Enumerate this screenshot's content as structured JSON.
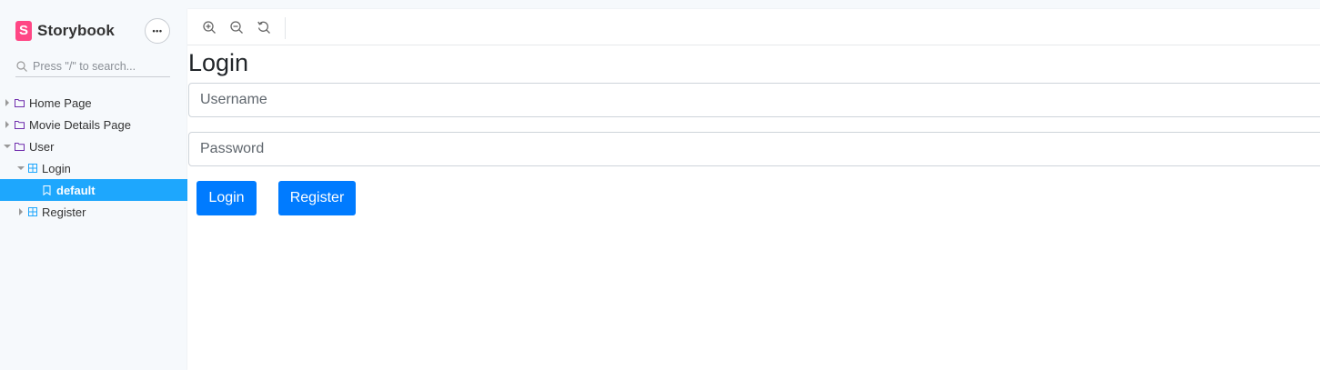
{
  "app": {
    "brand": "Storybook",
    "menu_glyph": "•••"
  },
  "search": {
    "placeholder": "Press \"/\" to search..."
  },
  "tree": {
    "items": [
      {
        "label": "Home Page",
        "type": "folder",
        "expanded": false
      },
      {
        "label": "Movie Details Page",
        "type": "folder",
        "expanded": false
      },
      {
        "label": "User",
        "type": "folder",
        "expanded": true
      },
      {
        "label": "Login",
        "type": "component",
        "expanded": true
      },
      {
        "label": "default",
        "type": "story",
        "selected": true
      },
      {
        "label": "Register",
        "type": "component",
        "expanded": false
      }
    ]
  },
  "toolbar": {
    "tools": [
      "zoom-in",
      "zoom-out",
      "zoom-reset"
    ]
  },
  "story": {
    "title": "Login",
    "username_placeholder": "Username",
    "password_placeholder": "Password",
    "login_label": "Login",
    "register_label": "Register"
  },
  "colors": {
    "brand": "#ff4785",
    "selected": "#1ea7fd",
    "button": "#007bff"
  }
}
